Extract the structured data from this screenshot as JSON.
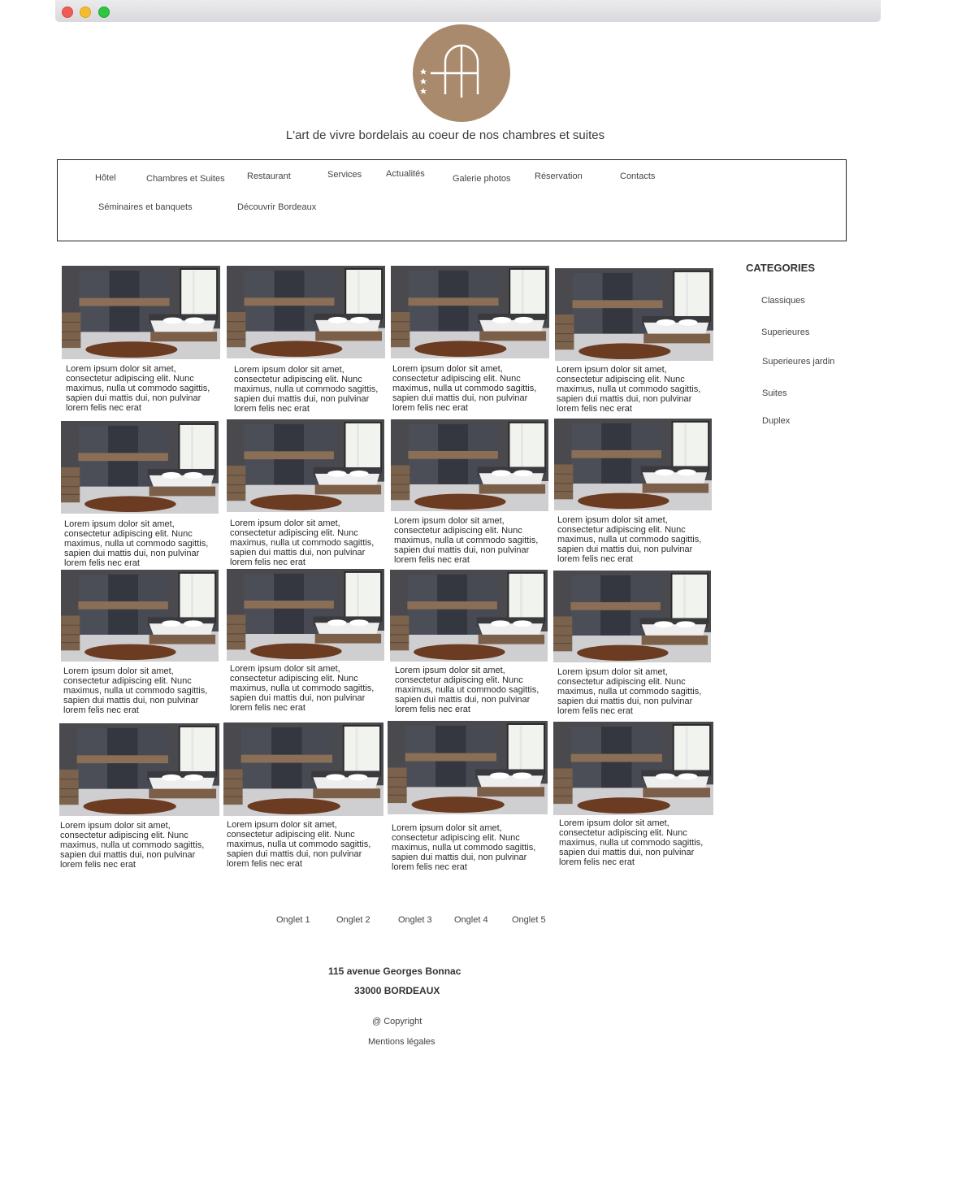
{
  "header": {
    "logo_letters": "HA",
    "tagline": "L'art de vivre bordelais au coeur de nos chambres et suites"
  },
  "nav": {
    "items": [
      "Hôtel",
      "Chambres et Suites",
      "Restaurant",
      "Services",
      "Actualités",
      "Galerie photos",
      "Réservation",
      "Contacts",
      "Séminaires et banquets",
      "Découvrir Bordeaux"
    ]
  },
  "gallery": {
    "description": "Lorem ipsum dolor sit amet, consectetur adipiscing elit. Nunc maximus, nulla ut commodo sagittis, sapien dui mattis dui, non pulvinar lorem felis nec erat",
    "card_count": 16
  },
  "sidebar": {
    "title": "CATEGORIES",
    "items": [
      "Classiques",
      "Superieures",
      "Superieures jardin",
      "Suites",
      "Duplex"
    ]
  },
  "tabs": [
    "Onglet 1",
    "Onglet 2",
    "Onglet 3",
    "Onglet 4",
    "Onglet 5"
  ],
  "footer": {
    "address_line1": "115 avenue Georges Bonnac",
    "address_line2": "33000 BORDEAUX",
    "copyright": "@ Copyright",
    "legal": "Mentions légales"
  },
  "colors": {
    "logo_bg": "#a98a6d",
    "nav_border": "#222222"
  }
}
